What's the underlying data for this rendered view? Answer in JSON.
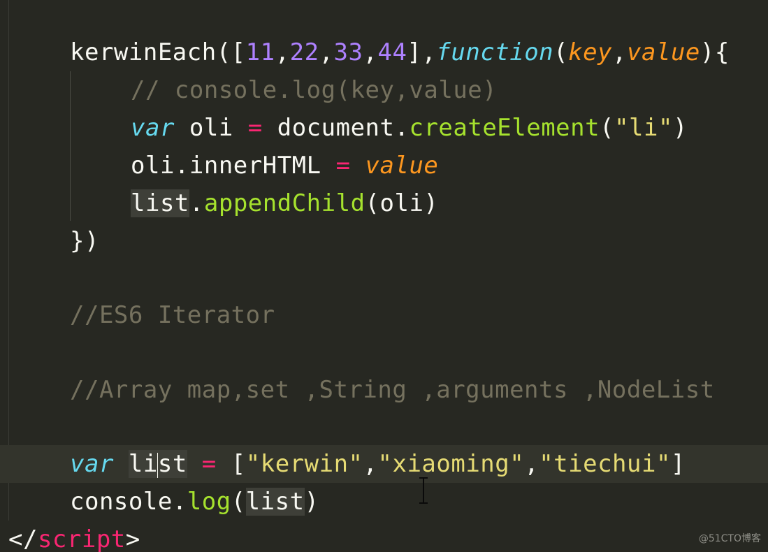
{
  "editor": {
    "theme_colors": {
      "background": "#272822",
      "text": "#f8f8f2",
      "number": "#ae81ff",
      "keyword": "#66d9ef",
      "parameter": "#fd971f",
      "operator": "#f92672",
      "function": "#a6e22e",
      "string": "#e6db74",
      "comment": "#75715e"
    },
    "line1": {
      "call": "kerwinEach",
      "open": "([",
      "n1": "11",
      "n2": "22",
      "n3": "33",
      "n4": "44",
      "comma": ",",
      "close_arr": "],",
      "function_kw": "function",
      "paren_open": "(",
      "key": "key",
      "value": "value",
      "brace": "){"
    },
    "line2": {
      "comment": "// console.log(key,value)"
    },
    "line3": {
      "var_kw": "var",
      "name": " oli ",
      "eq": "=",
      "obj": " document.",
      "method": "createElement",
      "arg_open": "(",
      "arg": "\"li\"",
      "arg_close": ")"
    },
    "line4": {
      "target": "oli.innerHTML ",
      "eq": "=",
      "value": "value"
    },
    "line5": {
      "list": "list",
      "dot": ".",
      "method": "appendChild",
      "args": "(oli)"
    },
    "line6": {
      "close": "})"
    },
    "line7": {
      "comment": "//ES6 Iterator"
    },
    "line8": {
      "comment": "//Array map,set ,String ,arguments ,NodeList"
    },
    "line9": {
      "var_kw": "var",
      "list_a": "li",
      "list_b": "st",
      "eq": "=",
      "bracket_open": "[",
      "s1": "\"kerwin\"",
      "comma": ",",
      "s2": "\"xiaoming\"",
      "s3": "\"tiechui\"",
      "bracket_close": "]"
    },
    "line10": {
      "obj": "console.",
      "method": "log",
      "paren_open": "(",
      "list": "list",
      "paren_close": ")"
    },
    "line11": {
      "open": "</",
      "tag": "script",
      "close": ">"
    },
    "watermark": "@51CTO博客"
  }
}
